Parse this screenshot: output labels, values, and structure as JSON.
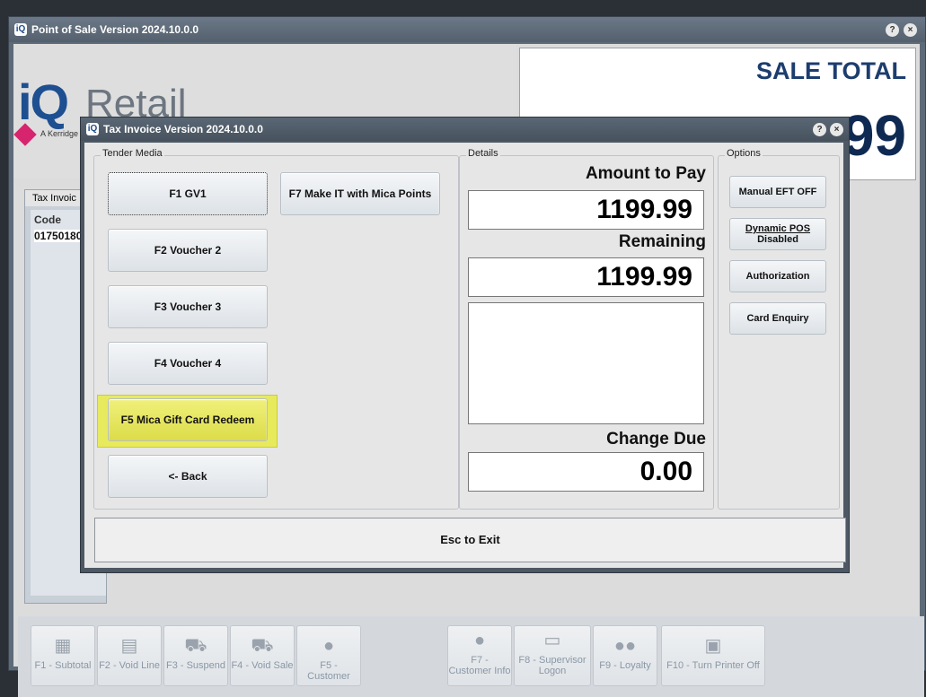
{
  "main_window": {
    "icon": "iq-logo-icon",
    "title": "Point of Sale Version 2024.10.0.0",
    "help": "?",
    "close": "×"
  },
  "logo": {
    "mark": "iQ",
    "word": "Retail",
    "tagline": "A Kerridge"
  },
  "sale_total": {
    "label": "SALE TOTAL",
    "value": "99"
  },
  "list": {
    "tab": "Tax Invoic",
    "column": "Code",
    "row": "01750180"
  },
  "dialog": {
    "title": "Tax Invoice Version 2024.10.0.0",
    "help": "?",
    "close": "×",
    "tender_media": {
      "label": "Tender Media",
      "buttons": [
        "F1 GV1",
        "F2 Voucher 2",
        "F3 Voucher 3",
        "F4 Voucher 4",
        "F5 Mica Gift Card Redeem",
        "<- Back"
      ],
      "f7": "F7 Make IT with Mica Points"
    },
    "details": {
      "label": "Details",
      "amount_label": "Amount to Pay",
      "amount": "1199.99",
      "remaining_label": "Remaining",
      "remaining": "1199.99",
      "change_label": "Change Due",
      "change": "0.00"
    },
    "options": {
      "label": "Options",
      "manual_eft": "Manual EFT OFF",
      "dynamic_pos_line1": "Dynamic POS",
      "dynamic_pos_line2": "Disabled",
      "authorization": "Authorization",
      "card_enquiry": "Card Enquiry"
    },
    "exit": "Esc to Exit"
  },
  "toolbar": [
    {
      "label": "F1 - Subtotal",
      "icon": "calculator-icon"
    },
    {
      "label": "F2 - Void Line",
      "icon": "void-line-icon"
    },
    {
      "label": "F3 - Suspend",
      "icon": "cart-suspend-icon"
    },
    {
      "label": "F4 - Void Sale",
      "icon": "cart-void-icon"
    },
    {
      "label": "F5 - Customer",
      "icon": "customer-icon"
    },
    {
      "label": "F7 - Customer Info",
      "icon": "customer-info-icon"
    },
    {
      "label": "F8 - Supervisor Logon",
      "icon": "supervisor-icon"
    },
    {
      "label": "F9 - Loyalty",
      "icon": "loyalty-icon"
    },
    {
      "label": "F10 - Turn Printer Off",
      "icon": "printer-icon"
    }
  ],
  "colors": {
    "sale_total_text": "#1c3d6e",
    "highlight": "#e8ea5e",
    "logo_blue": "#1d4f91",
    "logo_pink": "#d6246e"
  }
}
